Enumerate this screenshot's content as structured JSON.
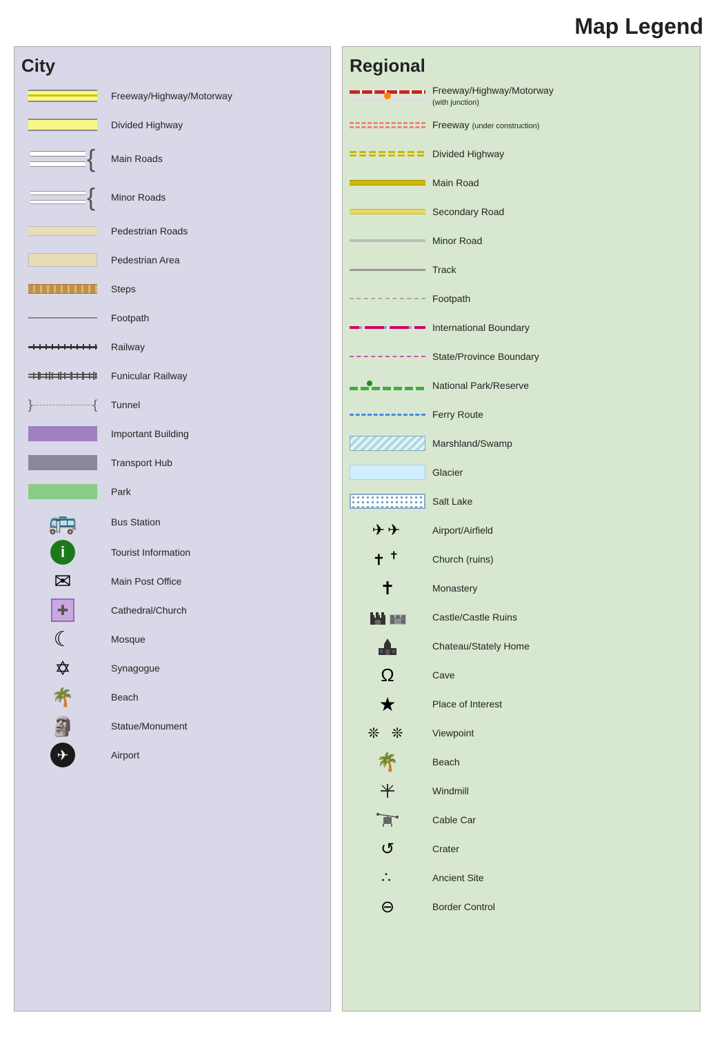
{
  "header": {
    "title": "Map Legend"
  },
  "city": {
    "section_title": "City",
    "items": [
      {
        "id": "freeway",
        "label": "Freeway/Highway/Motorway",
        "symbol_type": "road-freeway"
      },
      {
        "id": "divided-highway",
        "label": "Divided Highway",
        "symbol_type": "road-divided"
      },
      {
        "id": "main-roads",
        "label": "Main Roads",
        "symbol_type": "road-main-group"
      },
      {
        "id": "minor-roads",
        "label": "Minor Roads",
        "symbol_type": "road-minor-group"
      },
      {
        "id": "pedestrian-roads",
        "label": "Pedestrian Roads",
        "symbol_type": "road-pedestrian"
      },
      {
        "id": "pedestrian-area",
        "label": "Pedestrian Area",
        "symbol_type": "road-ped-area"
      },
      {
        "id": "steps",
        "label": "Steps",
        "symbol_type": "road-steps"
      },
      {
        "id": "footpath",
        "label": "Footpath",
        "symbol_type": "road-footpath"
      },
      {
        "id": "railway",
        "label": "Railway",
        "symbol_type": "road-railway"
      },
      {
        "id": "funicular",
        "label": "Funicular Railway",
        "symbol_type": "road-funicular"
      },
      {
        "id": "tunnel",
        "label": "Tunnel",
        "symbol_type": "tunnel"
      },
      {
        "id": "important-building",
        "label": "Important Building",
        "symbol_type": "important-building"
      },
      {
        "id": "transport-hub",
        "label": "Transport Hub",
        "symbol_type": "transport-hub"
      },
      {
        "id": "park",
        "label": "Park",
        "symbol_type": "park"
      },
      {
        "id": "bus-station",
        "label": "Bus Station",
        "symbol_type": "icon",
        "icon": "🚌"
      },
      {
        "id": "tourist-info",
        "label": "Tourist Information",
        "symbol_type": "icon-circle-i",
        "icon": "ℹ"
      },
      {
        "id": "post-office",
        "label": "Main Post Office",
        "symbol_type": "icon",
        "icon": "✉"
      },
      {
        "id": "cathedral",
        "label": "Cathedral/Church",
        "symbol_type": "icon-cross-sq",
        "icon": "✚"
      },
      {
        "id": "mosque",
        "label": "Mosque",
        "symbol_type": "icon",
        "icon": "☾"
      },
      {
        "id": "synagogue",
        "label": "Synagogue",
        "symbol_type": "icon",
        "icon": "✡"
      },
      {
        "id": "beach",
        "label": "Beach",
        "symbol_type": "icon",
        "icon": "🏖"
      },
      {
        "id": "statue",
        "label": "Statue/Monument",
        "symbol_type": "icon",
        "icon": "🗿"
      },
      {
        "id": "airport",
        "label": "Airport",
        "symbol_type": "icon-airport",
        "icon": "✈"
      }
    ]
  },
  "regional": {
    "section_title": "Regional",
    "items": [
      {
        "id": "reg-freeway",
        "label": "Freeway/Highway/Motorway",
        "sublabel": "(with junction)",
        "symbol_type": "reg-freeway"
      },
      {
        "id": "reg-freeway-uc",
        "label": "Freeway",
        "sublabel": "(under construction)",
        "symbol_type": "dashed-red"
      },
      {
        "id": "reg-divided",
        "label": "Divided Highway",
        "symbol_type": "double-dashed-yellow"
      },
      {
        "id": "reg-main-road",
        "label": "Main Road",
        "symbol_type": "solid-yellow"
      },
      {
        "id": "reg-secondary",
        "label": "Secondary Road",
        "symbol_type": "solid-yellow2"
      },
      {
        "id": "reg-minor",
        "label": "Minor Road",
        "symbol_type": "solid-gray"
      },
      {
        "id": "reg-track",
        "label": "Track",
        "symbol_type": "solid-gray2"
      },
      {
        "id": "reg-footpath",
        "label": "Footpath",
        "symbol_type": "dashed-gray"
      },
      {
        "id": "reg-intl-boundary",
        "label": "International Boundary",
        "symbol_type": "intl-boundary"
      },
      {
        "id": "reg-state-boundary",
        "label": "State/Province Boundary",
        "symbol_type": "state-boundary"
      },
      {
        "id": "reg-national-park",
        "label": "National Park/Reserve",
        "symbol_type": "natl-park"
      },
      {
        "id": "reg-ferry",
        "label": "Ferry Route",
        "symbol_type": "ferry-route"
      },
      {
        "id": "reg-marshland",
        "label": "Marshland/Swamp",
        "symbol_type": "marshland"
      },
      {
        "id": "reg-glacier",
        "label": "Glacier",
        "symbol_type": "glacier"
      },
      {
        "id": "reg-salt-lake",
        "label": "Salt Lake",
        "symbol_type": "salt-lake"
      },
      {
        "id": "reg-airport",
        "label": "Airport/Airfield",
        "symbol_type": "icon",
        "icon": "✈✈"
      },
      {
        "id": "reg-church",
        "label": "Church (ruins)",
        "symbol_type": "icon",
        "icon": "✝ ✝"
      },
      {
        "id": "reg-monastery",
        "label": "Monastery",
        "symbol_type": "icon",
        "icon": "✝"
      },
      {
        "id": "reg-castle",
        "label": "Castle/Castle Ruins",
        "symbol_type": "icon",
        "icon": "🏰"
      },
      {
        "id": "reg-chateau",
        "label": "Chateau/Stately Home",
        "symbol_type": "icon",
        "icon": "🏛"
      },
      {
        "id": "reg-cave",
        "label": "Cave",
        "symbol_type": "icon",
        "icon": "Ω"
      },
      {
        "id": "reg-poi",
        "label": "Place of Interest",
        "symbol_type": "icon",
        "icon": "★"
      },
      {
        "id": "reg-viewpoint",
        "label": "Viewpoint",
        "symbol_type": "icon",
        "icon": "❄ ❄"
      },
      {
        "id": "reg-beach",
        "label": "Beach",
        "symbol_type": "icon",
        "icon": "🌴"
      },
      {
        "id": "reg-windmill",
        "label": "Windmill",
        "symbol_type": "icon",
        "icon": "⚙"
      },
      {
        "id": "reg-cable-car",
        "label": "Cable Car",
        "symbol_type": "icon",
        "icon": "🚡"
      },
      {
        "id": "reg-crater",
        "label": "Crater",
        "symbol_type": "icon",
        "icon": "↺"
      },
      {
        "id": "reg-ancient",
        "label": "Ancient Site",
        "symbol_type": "icon",
        "icon": "∴"
      },
      {
        "id": "reg-border",
        "label": "Border Control",
        "symbol_type": "icon",
        "icon": "⊖"
      }
    ]
  }
}
